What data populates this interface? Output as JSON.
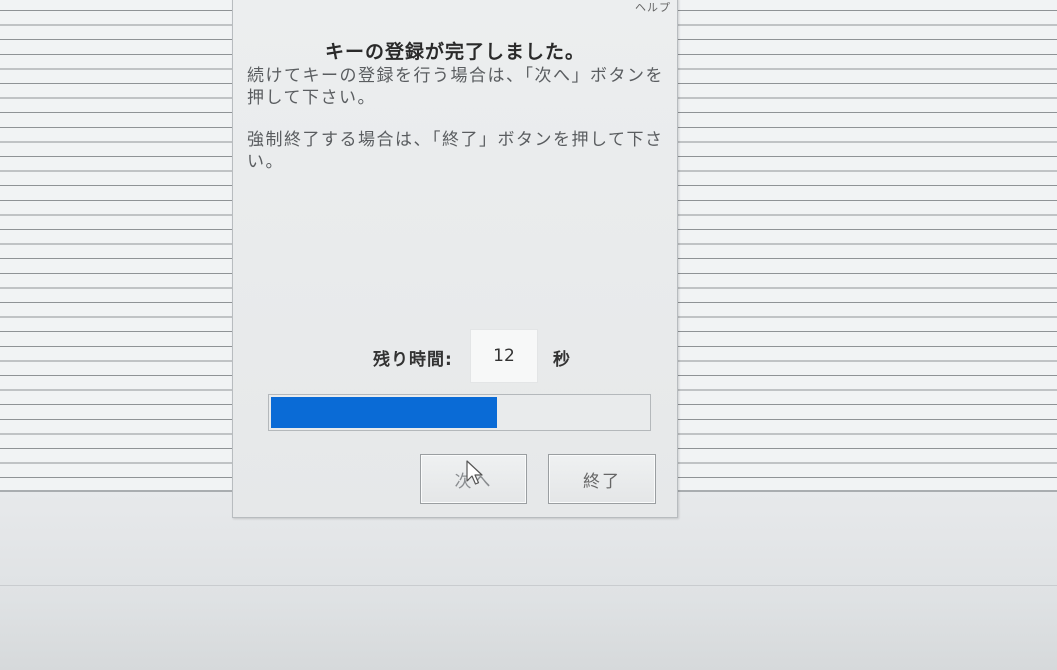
{
  "dialog": {
    "help_label": "ヘルプ",
    "title": "キーの登録が完了しました。",
    "message_continue": "続けてキーの登録を行う場合は、「次へ」ボタンを押して下さい。",
    "message_force_end": "強制終了する場合は、「終了」ボタンを押して下さい。",
    "timer": {
      "label": "残り時間:",
      "value": "12",
      "unit": "秒"
    },
    "progress": {
      "fraction": 0.6
    },
    "buttons": {
      "next_label": "次へ",
      "end_label": "終了"
    }
  },
  "colors": {
    "progress_fill": "#0a6bd6",
    "background_lines": "#8f9396",
    "dialog_bg": "#eceeef"
  },
  "icons": {
    "cursor": "mouse-pointer-icon"
  }
}
